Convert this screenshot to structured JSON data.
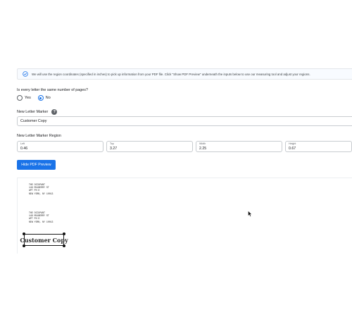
{
  "info": {
    "text": "We will use the region coordinates (specified in inches) to pick up information from your PDF file. Click \"Show PDF Preview\" underneath the inputs below to use our measuring tool and adjust your regions.",
    "icon": "check-circle-icon"
  },
  "pages_question": {
    "label": "Is every letter the same number of pages?",
    "options": [
      {
        "label": "Yes",
        "checked": false
      },
      {
        "label": "No",
        "checked": true
      }
    ]
  },
  "marker": {
    "label": "New Letter Marker",
    "value": "Customer Copy",
    "help_icon": "question-circle-icon"
  },
  "region": {
    "label": "New Letter Marker Region",
    "left": {
      "label": "Left",
      "value": "0.46"
    },
    "top": {
      "label": "Top",
      "value": "3.27"
    },
    "width": {
      "label": "Width",
      "value": "2.25"
    },
    "height": {
      "label": "Height",
      "value": "0.67"
    }
  },
  "preview_button": {
    "label": "Hide PDF Preview"
  },
  "preview": {
    "address_1": [
      "THE OCCUPANT",
      "149 MULBERRY ST",
      "APT PH D",
      "NEW YORK, NY 10013"
    ],
    "address_2": [
      "THE OCCUPANT",
      "149 MULBERRY ST",
      "APT PH D",
      "NEW YORK, NY 10013"
    ],
    "marker_text": "Customer Copy"
  },
  "colors": {
    "accent": "#1a73e8",
    "border": "#c8ccd0"
  }
}
